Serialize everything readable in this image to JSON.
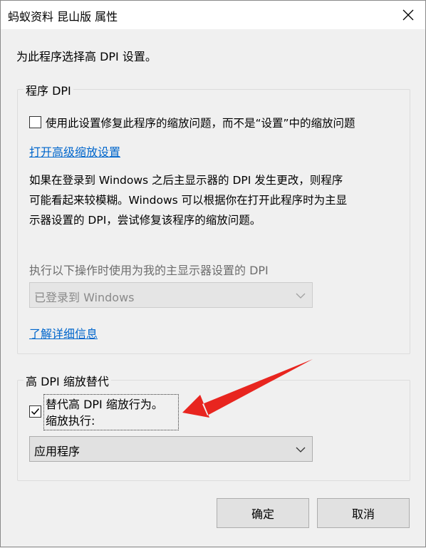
{
  "window": {
    "title": "蚂蚁资料 昆山版 属性",
    "close_icon": "close-icon"
  },
  "intro_text": "为此程序选择高 DPI 设置。",
  "program_dpi": {
    "legend": "程序 DPI",
    "checkbox_label": "使用此设置修复此程序的缩放问题，而不是“设置”中的缩放问题",
    "checkbox_checked": false,
    "advanced_link": "打开高级缩放设置",
    "description_lines": [
      "如果在登录到 Windows 之后主显示器的 DPI 发生更改，则程序",
      "可能看起来较模糊。Windows 可以根据你在打开此程序时为主显",
      "示器设置的 DPI，尝试修复该程序的缩放问题。"
    ],
    "dpi_select_label": "执行以下操作时使用为我的主显示器设置的 DPI",
    "dpi_select_value": "已登录到 Windows",
    "learn_more_link": "了解详细信息"
  },
  "high_dpi_override": {
    "legend": "高 DPI 缩放替代",
    "checkbox_checked": true,
    "checkbox_label_line1": "替代高 DPI 缩放行为。",
    "checkbox_label_line2": "缩放执行:",
    "scaling_select_value": "应用程序"
  },
  "buttons": {
    "ok": "确定",
    "cancel": "取消"
  },
  "annotation": {
    "arrow_color": "#e8251f"
  }
}
